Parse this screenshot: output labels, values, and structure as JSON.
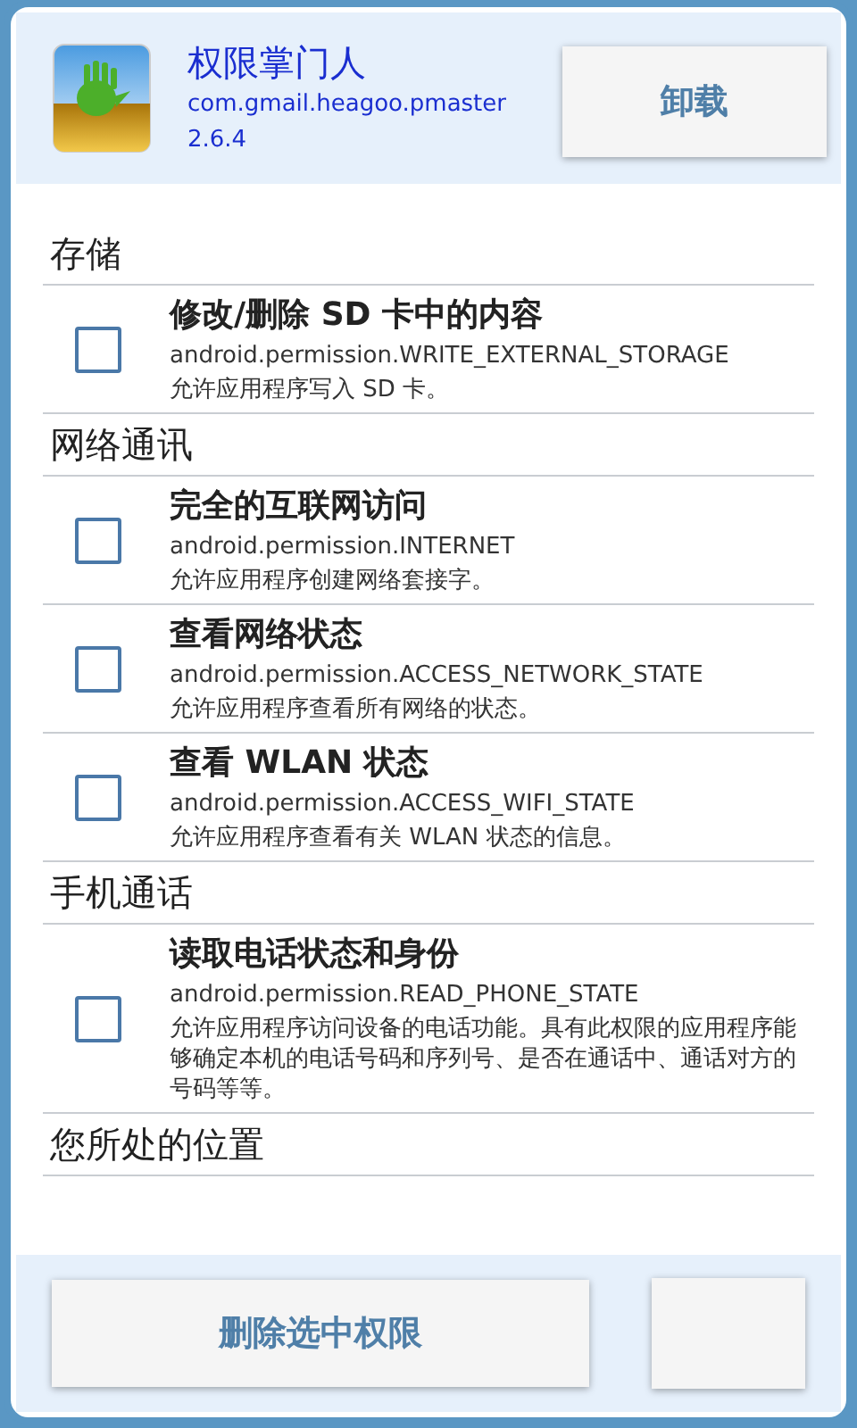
{
  "app": {
    "name": "权限掌门人",
    "package": "com.gmail.heagoo.pmaster",
    "version": "2.6.4",
    "uninstall_button": "卸载"
  },
  "sections": [
    {
      "title": "存储",
      "permissions": [
        {
          "title": "修改/删除 SD 卡中的内容",
          "permission": "android.permission.WRITE_EXTERNAL_STORAGE",
          "description": "允许应用程序写入 SD 卡。",
          "checked": false
        }
      ]
    },
    {
      "title": "网络通讯",
      "permissions": [
        {
          "title": "完全的互联网访问",
          "permission": "android.permission.INTERNET",
          "description": "允许应用程序创建网络套接字。",
          "checked": false
        },
        {
          "title": "查看网络状态",
          "permission": "android.permission.ACCESS_NETWORK_STATE",
          "description": "允许应用程序查看所有网络的状态。",
          "checked": false
        },
        {
          "title": "查看 WLAN 状态",
          "permission": "android.permission.ACCESS_WIFI_STATE",
          "description": "允许应用程序查看有关 WLAN 状态的信息。",
          "checked": false
        }
      ]
    },
    {
      "title": "手机通话",
      "permissions": [
        {
          "title": "读取电话状态和身份",
          "permission": "android.permission.READ_PHONE_STATE",
          "description": "允许应用程序访问设备的电话功能。具有此权限的应用程序能够确定本机的电话号码和序列号、是否在通话中、通话对方的号码等等。",
          "checked": false
        }
      ]
    },
    {
      "title": "您所处的位置"
    }
  ],
  "footer": {
    "remove_button": "删除选中权限"
  }
}
